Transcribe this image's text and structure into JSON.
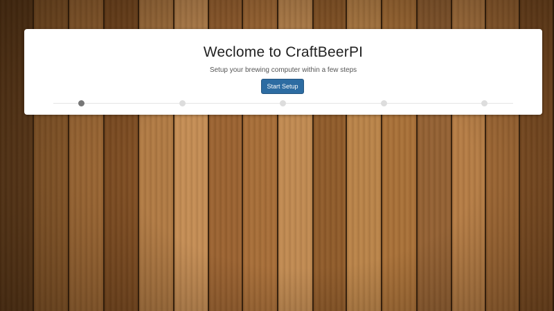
{
  "page": {
    "title": "Weclome to CraftBeerPI",
    "subtitle": "Setup your brewing computer within a few steps",
    "start_button_label": "Start Setup"
  },
  "wizard": {
    "total_steps": 5,
    "current_step": 1
  },
  "colors": {
    "button": "#2d6ca2",
    "active_step": "#777777",
    "inactive_step": "#dddddd",
    "card": "#ffffff"
  }
}
